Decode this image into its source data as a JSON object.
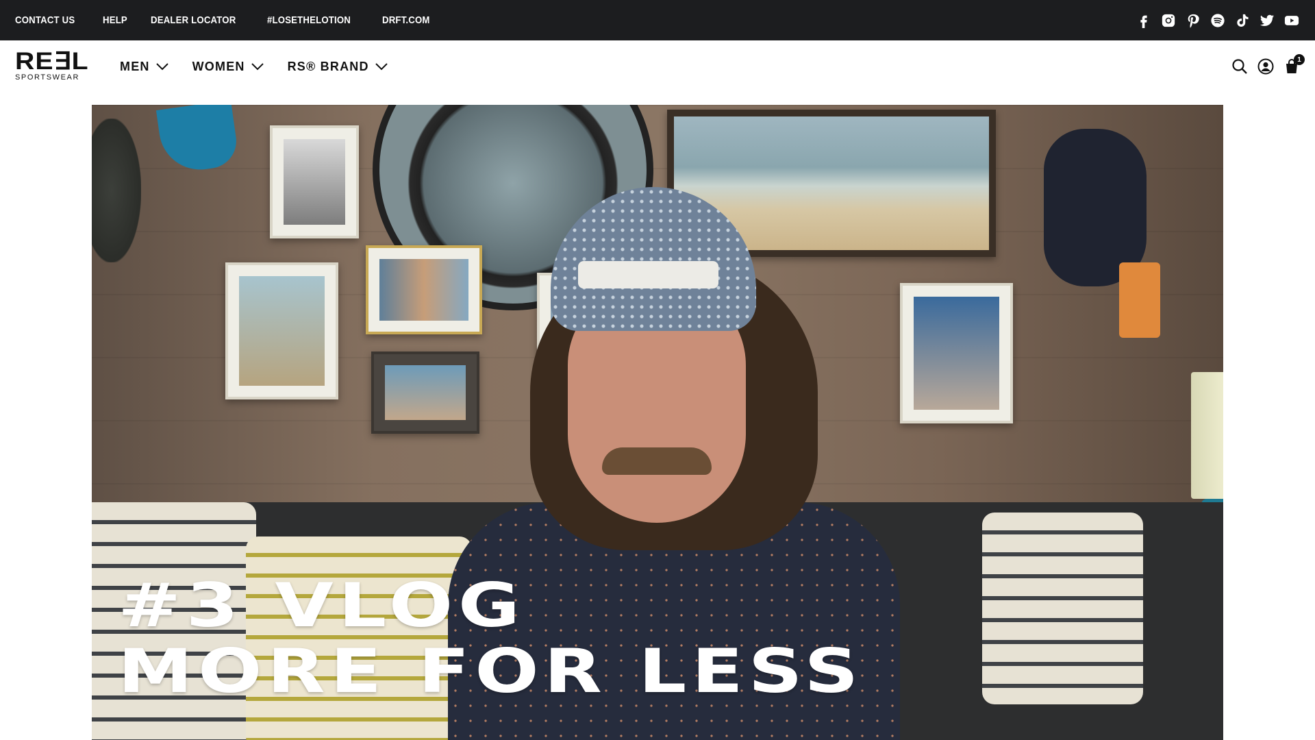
{
  "topbar": {
    "links": [
      "CONTACT US",
      "HELP",
      "DEALER LOCATOR",
      "#LOSETHELOTION",
      "DRFT.COM"
    ],
    "socials": [
      "facebook-icon",
      "instagram-icon",
      "pinterest-icon",
      "spotify-icon",
      "tiktok-icon",
      "twitter-icon",
      "youtube-icon"
    ]
  },
  "header": {
    "logo_main": "RE∃L",
    "logo_sub": "SPORTSWEAR",
    "nav": [
      "MEN",
      "WOMEN",
      "RS® BRAND"
    ],
    "cart_count": "1"
  },
  "hero": {
    "line1": "#3 VLOG",
    "line2": "MORE FOR LESS"
  },
  "colors": {
    "topbar_bg": "#1c1d1f",
    "header_bg": "#ffffff",
    "text": "#111111"
  }
}
